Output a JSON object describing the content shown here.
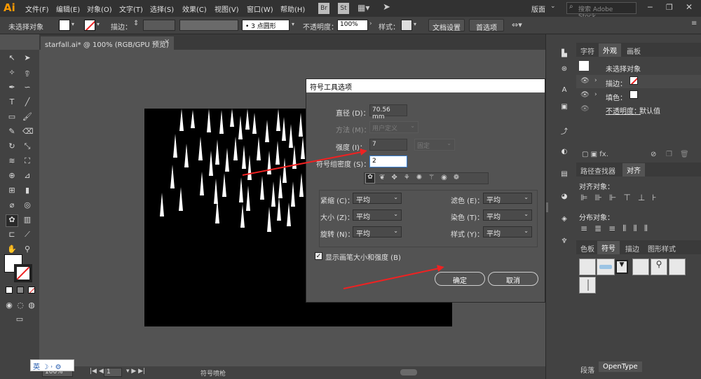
{
  "app": {
    "logo": "Ai",
    "menus": [
      "文件(F)",
      "编辑(E)",
      "对象(O)",
      "文字(T)",
      "选择(S)",
      "效果(C)",
      "视图(V)",
      "窗口(W)",
      "帮助(H)"
    ],
    "br": "Br",
    "st": "St",
    "workspace": "版面",
    "stock_placeholder": "搜索 Adobe Stock"
  },
  "control": {
    "selection": "未选择对象",
    "stroke_label": "描边：",
    "brush": "3 点圆形",
    "opacity_label": "不透明度：",
    "opacity": "100%",
    "style_label": "样式：",
    "doc_setup": "文档设置",
    "prefs": "首选项"
  },
  "document": {
    "tab": "starfall.ai* @ 100% (RGB/GPU 预览)",
    "close": "×"
  },
  "status": {
    "zoom": "100%",
    "page": "1",
    "tool": "符号喷枪"
  },
  "ime": {
    "label": "英"
  },
  "appearance": {
    "tabs": [
      "字符",
      "外观",
      "画板"
    ],
    "title": "未选择对象",
    "stroke_label": "描边：",
    "fill_label": "填色：",
    "opacity_label": "不透明度：",
    "opacity": "默认值"
  },
  "align": {
    "tabs": [
      "路径查找器",
      "对齐"
    ],
    "align_objects": "对齐对象：",
    "distribute_objects": "分布对象："
  },
  "swatches": {
    "tabs": [
      "色板",
      "符号",
      "描边",
      "图形样式"
    ]
  },
  "bottom_panel": {
    "tabs": [
      "段落",
      "OpenType"
    ]
  },
  "dialog": {
    "title": "符号工具选项",
    "diameter_label": "直径 (D)：",
    "diameter": "70.56 mm",
    "method_label": "方法 (M)：",
    "method": "用户定义",
    "intensity_label": "强度 (I)：",
    "intensity": "7",
    "intensity_mode": "固定",
    "density_label": "符号组密度 (S)：",
    "density": "2",
    "left_rows": [
      {
        "label": "紧缩 (C)：",
        "value": "平均"
      },
      {
        "label": "大小 (Z)：",
        "value": "平均"
      },
      {
        "label": "旋转 (N)：",
        "value": "平均"
      }
    ],
    "right_rows": [
      {
        "label": "滤色 (E)：",
        "value": "平均"
      },
      {
        "label": "染色 (T)：",
        "value": "平均"
      },
      {
        "label": "样式 (Y)：",
        "value": "平均"
      }
    ],
    "show_brush": "显示画笔大小和强度 (B)",
    "ok": "确定",
    "cancel": "取消"
  },
  "colors": {
    "arrow": "#e22222",
    "app_bg": "#535353",
    "panel": "#424242",
    "accent": "#ff9a00"
  }
}
